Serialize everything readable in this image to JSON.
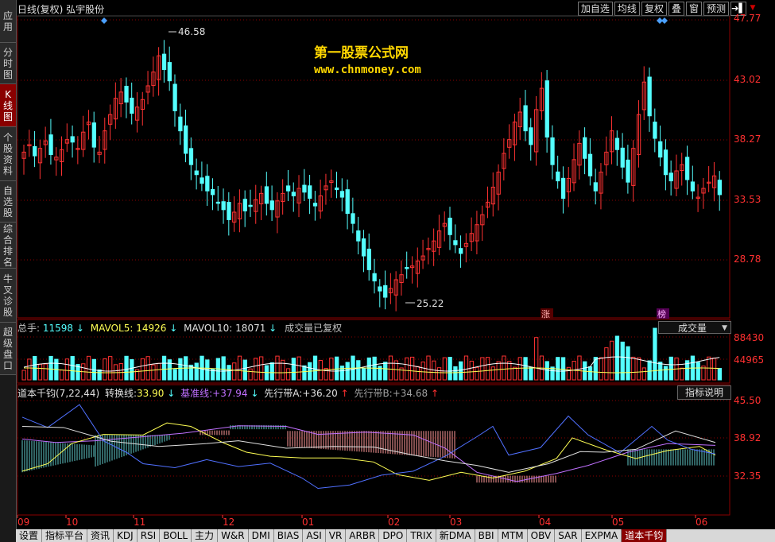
{
  "left_tabs": [
    {
      "label": "应用",
      "active": false
    },
    {
      "label": "分时图",
      "active": false
    },
    {
      "label": "K线图",
      "active": true
    },
    {
      "label": "个股资料",
      "active": false
    },
    {
      "label": "自选股",
      "active": false
    },
    {
      "label": "综合排名",
      "active": false
    },
    {
      "label": "牛叉诊股",
      "active": false
    },
    {
      "label": "超级盘口",
      "active": false
    }
  ],
  "header": {
    "title": "日线(复权)  弘宇股份",
    "buttons": [
      "加自选",
      "均线",
      "复权",
      "叠",
      "窗",
      "预测"
    ],
    "arrow_label": "➔▌",
    "dropdown_label": "▼"
  },
  "watermark": {
    "title": "第一股票公式网",
    "url": "www.chnmoney.com"
  },
  "price_axis": {
    "ticks": [
      "47.77",
      "43.02",
      "38.27",
      "33.53",
      "28.78"
    ]
  },
  "price_annotations": {
    "high": "46.58",
    "low": "25.22"
  },
  "event_markers": {
    "m1": "涨",
    "m2": "榜"
  },
  "volume_panel": {
    "total_label": "总手:",
    "total_value": "11598",
    "mavol5_label": "MAVOL5:",
    "mavol5_value": "14926",
    "mavol10_label": "MAVOL10:",
    "mavol10_value": "18071",
    "note": "成交量已复权",
    "selector": "成交量",
    "axis": [
      "88430",
      "44965"
    ]
  },
  "indicator_panel": {
    "name": "道本千钧(7,22,44)",
    "conv_label": "转换线:",
    "conv_value": "33.90",
    "base_label": "基准线:",
    "base_value": "+37.94",
    "spanA_label": "先行带A:",
    "spanA_value": "+36.20",
    "spanB_label": "先行带B:",
    "spanB_value": "+34.68",
    "help_button": "指标说明",
    "axis": [
      "45.50",
      "38.92",
      "32.35"
    ]
  },
  "time_axis": [
    "09",
    "10",
    "11",
    "12",
    "01",
    "02",
    "03",
    "04",
    "05",
    "06"
  ],
  "bottom_tabs": [
    {
      "label": "设置",
      "active": false
    },
    {
      "label": "指标平台",
      "active": false
    },
    {
      "label": "资讯",
      "active": false
    },
    {
      "label": "KDJ",
      "active": false
    },
    {
      "label": "RSI",
      "active": false
    },
    {
      "label": "BOLL",
      "active": false
    },
    {
      "label": "主力",
      "active": false
    },
    {
      "label": "W&R",
      "active": false
    },
    {
      "label": "DMI",
      "active": false
    },
    {
      "label": "BIAS",
      "active": false
    },
    {
      "label": "ASI",
      "active": false
    },
    {
      "label": "VR",
      "active": false
    },
    {
      "label": "ARBR",
      "active": false
    },
    {
      "label": "DPO",
      "active": false
    },
    {
      "label": "TRIX",
      "active": false
    },
    {
      "label": "新DMA",
      "active": false
    },
    {
      "label": "BBI",
      "active": false
    },
    {
      "label": "MTM",
      "active": false
    },
    {
      "label": "OBV",
      "active": false
    },
    {
      "label": "SAR",
      "active": false
    },
    {
      "label": "EXPMA",
      "active": false
    },
    {
      "label": "道本千钧",
      "active": true
    }
  ],
  "colors": {
    "up": "#ff3232",
    "down": "#54ffff",
    "grid": "#8b0000",
    "axis": "#ff3030"
  },
  "chart_data": {
    "type": "candlestick",
    "price_range": [
      25.22,
      47.77
    ],
    "high": 46.58,
    "low": 25.22,
    "closes": [
      37.2,
      37.8,
      36.9,
      37.5,
      38.1,
      37.0,
      36.8,
      37.4,
      38.2,
      38.0,
      37.5,
      38.8,
      39.6,
      37.6,
      37.2,
      38.9,
      40.2,
      41.5,
      42.0,
      41.2,
      40.3,
      40.8,
      41.4,
      42.5,
      43.6,
      44.9,
      43.8,
      42.9,
      40.5,
      38.9,
      37.1,
      36.2,
      35.4,
      34.7,
      34.1,
      33.8,
      33.2,
      32.6,
      31.8,
      32.4,
      33.1,
      32.5,
      32.9,
      33.4,
      33.9,
      33.1,
      32.6,
      33.3,
      33.9,
      34.1,
      33.7,
      34.3,
      34.0,
      33.5,
      32.9,
      33.7,
      34.5,
      34.9,
      34.2,
      33.6,
      32.3,
      31.5,
      30.1,
      28.9,
      27.8,
      26.9,
      26.1,
      25.6,
      26.3,
      27.0,
      27.4,
      27.9,
      28.1,
      28.5,
      28.9,
      29.5,
      30.1,
      30.9,
      31.5,
      30.6,
      29.8,
      29.1,
      29.9,
      30.7,
      31.4,
      32.2,
      33.2,
      34.4,
      35.6,
      37.1,
      38.2,
      39.6,
      40.4,
      38.9,
      37.8,
      40.6,
      42.3,
      38.4,
      36.2,
      34.9,
      33.5,
      35.1,
      36.6,
      37.9,
      36.7,
      35.3,
      34.1,
      35.6,
      37.2,
      38.9,
      37.4,
      36.0,
      34.8,
      37.5,
      40.2,
      42.8,
      40.1,
      38.3,
      36.8,
      35.4,
      34.9,
      35.7,
      36.2,
      35.0,
      34.1,
      33.6,
      34.3,
      34.8,
      35.3,
      33.8
    ]
  }
}
